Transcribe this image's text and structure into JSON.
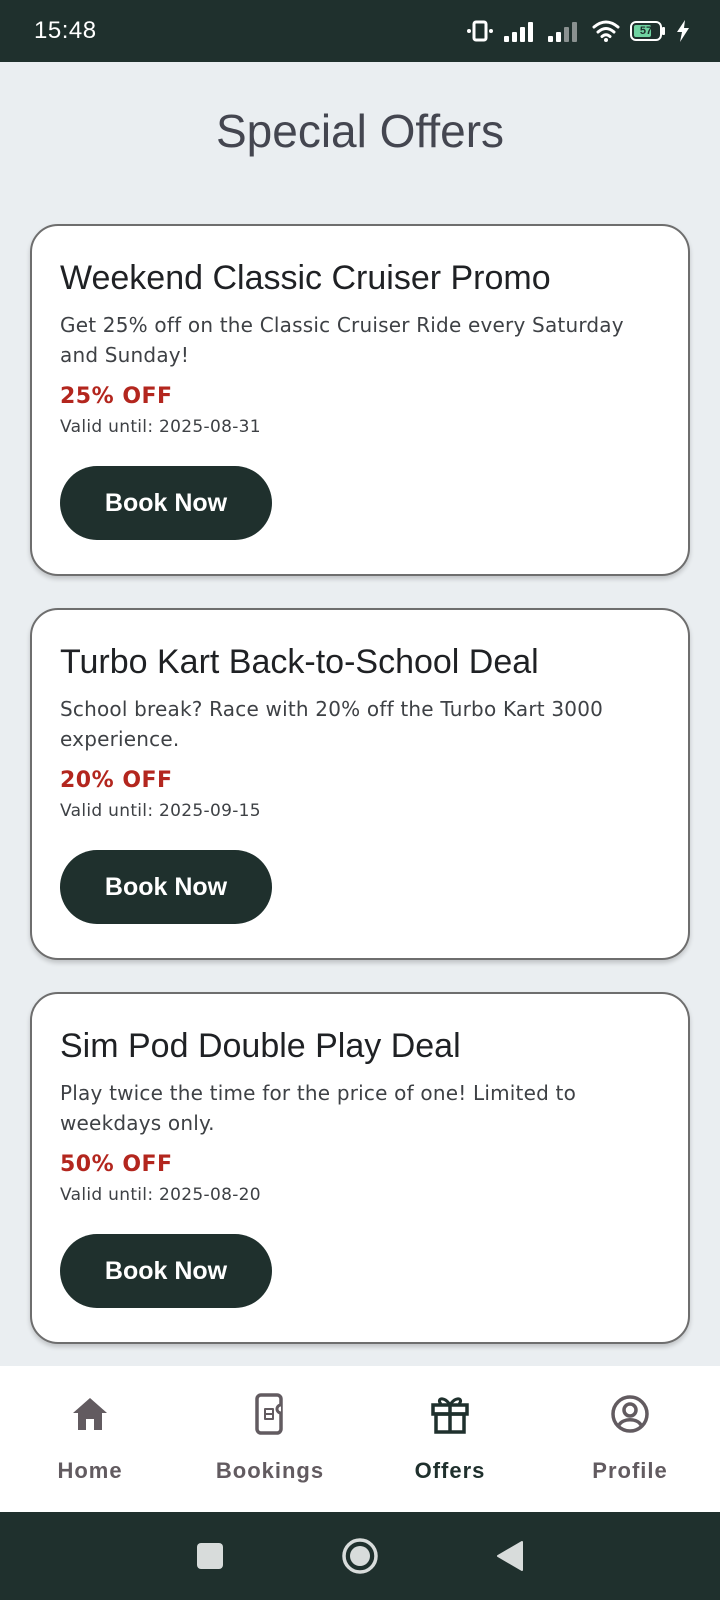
{
  "status_bar": {
    "time": "15:48",
    "battery_level": "57",
    "icons": [
      "vibrate-icon",
      "signal-icon",
      "signal-icon",
      "wifi-icon",
      "battery-icon",
      "charging-icon"
    ]
  },
  "page": {
    "title": "Special Offers"
  },
  "offers": [
    {
      "title": "Weekend Classic Cruiser Promo",
      "description": "Get 25% off on the Classic Cruiser Ride every Saturday and Sunday!",
      "discount": "25% OFF",
      "valid_until": "Valid until: 2025-08-31",
      "button_label": "Book Now"
    },
    {
      "title": "Turbo Kart Back-to-School Deal",
      "description": "School break? Race with 20% off the Turbo Kart 3000 experience.",
      "discount": "20% OFF",
      "valid_until": "Valid until: 2025-09-15",
      "button_label": "Book Now"
    },
    {
      "title": "Sim Pod Double Play Deal",
      "description": "Play twice the time for the price of one! Limited to weekdays only.",
      "discount": "50% OFF",
      "valid_until": "Valid until: 2025-08-20",
      "button_label": "Book Now"
    }
  ],
  "bottom_nav": {
    "items": [
      {
        "label": "Home",
        "icon": "home-icon"
      },
      {
        "label": "Bookings",
        "icon": "ticket-icon"
      },
      {
        "label": "Offers",
        "icon": "gift-icon",
        "active": true
      },
      {
        "label": "Profile",
        "icon": "profile-icon"
      }
    ]
  },
  "colors": {
    "primary_dark": "#1f302d",
    "discount_red": "#b3261e",
    "background": "#eaeef1",
    "nav_inactive": "#625b60"
  }
}
